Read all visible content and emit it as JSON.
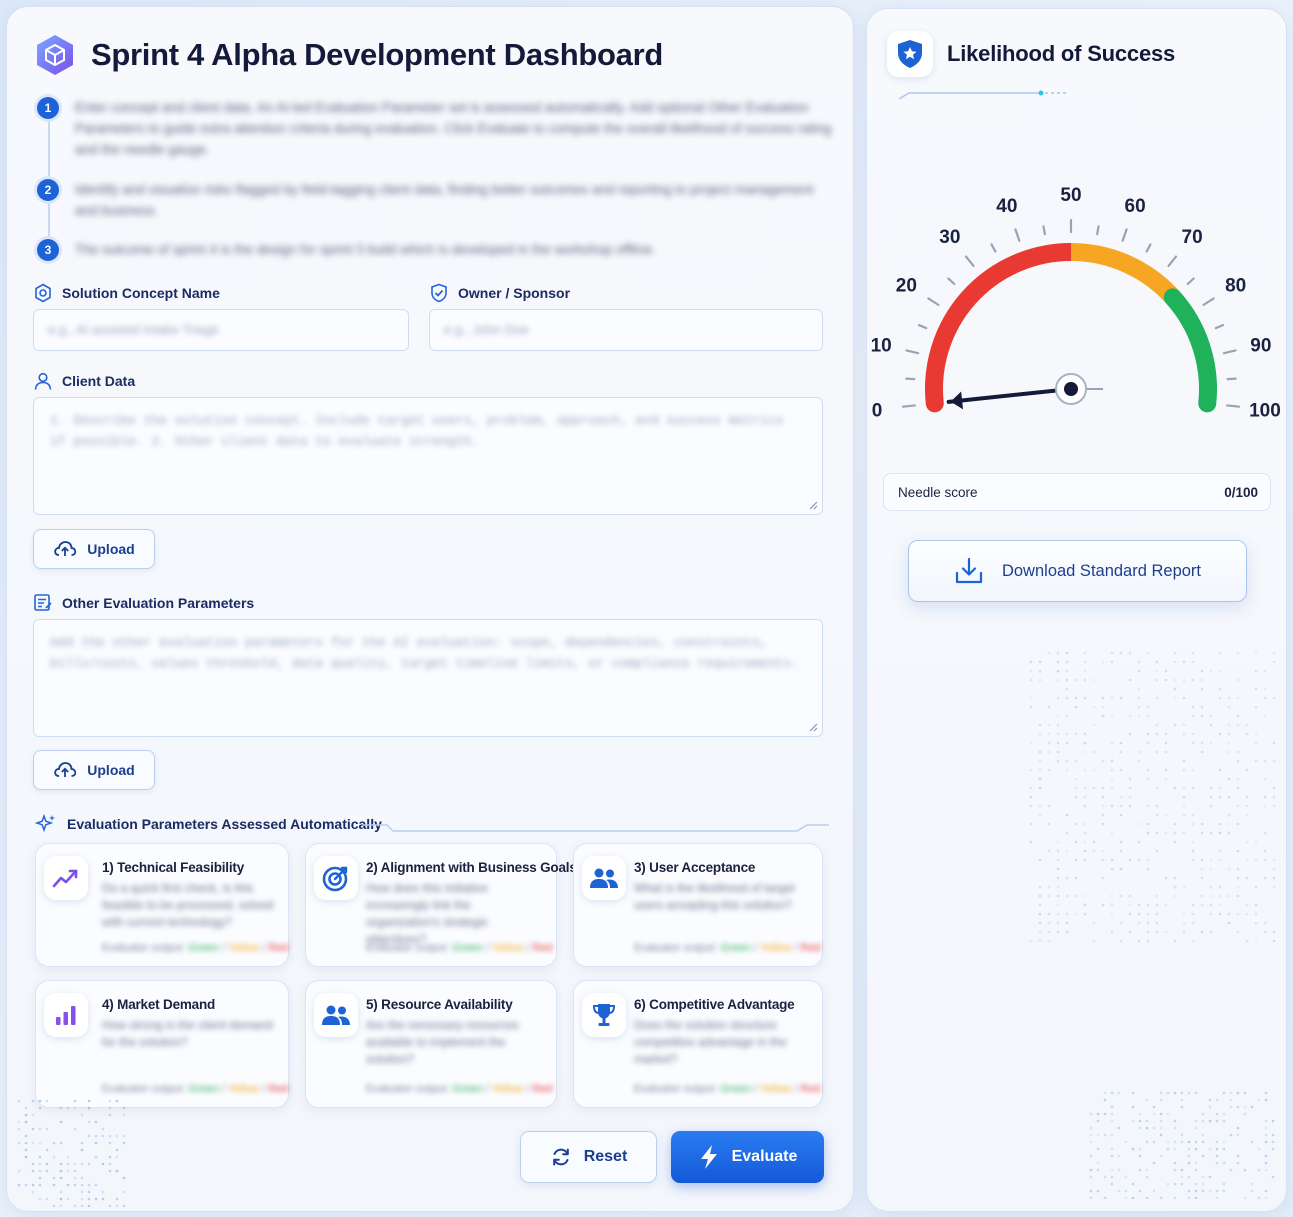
{
  "app": {
    "title": "Sprint 4 Alpha Development Dashboard"
  },
  "steps": [
    {
      "num": "1",
      "text": "Enter concept and client data. An AI-led Evaluation Parameter set is assessed automatically. Add optional Other Evaluation Parameters to guide extra attention criteria during evaluation. Click Evaluate to compute the overall likelihood of success rating and the needle gauge."
    },
    {
      "num": "2",
      "text": "Identify and visualize risks flagged by field-tagging client data, finding better outcomes and reporting to project management and business."
    },
    {
      "num": "3",
      "text": "The outcome of sprint 4 is the design for sprint 5 build which is developed in the workshop offline."
    }
  ],
  "form": {
    "concept_label": "Solution Concept Name",
    "concept_placeholder": "e.g., AI assisted Intake Triage",
    "owner_label": "Owner / Sponsor",
    "owner_placeholder": "e.g., John Doe",
    "client_label": "Client Data",
    "client_placeholder": "1. Describe the solution concept. Include target users, problem, approach, and success metrics if possible. 2. Other client data to evaluate strength.",
    "other_label": "Other Evaluation Parameters",
    "other_placeholder": "Add the other evaluation parameters for the AI evaluation: scope, dependencies, constraints, bills/costs, values threshold, data quality, target timeline limits, or compliance requirements.",
    "upload_label": "Upload"
  },
  "auto": {
    "heading": "Evaluation Parameters Assessed Automatically",
    "cards": [
      {
        "title": "1) Technical Feasibility",
        "desc": "Do a quick first check, is this feasible to be processed, solved with current technology?",
        "foot_prefix": "Evaluator output:",
        "g": "Green",
        "y": "Yellow",
        "r": "Red"
      },
      {
        "title": "2) Alignment with Business Goals",
        "desc": "How does this initiative increasingly link the organization's strategic objectives?",
        "foot_prefix": "Evaluator output:",
        "g": "Green",
        "y": "Yellow",
        "r": "Red"
      },
      {
        "title": "3) User Acceptance",
        "desc": "What is the likelihood of target users accepting this solution?",
        "foot_prefix": "Evaluator output:",
        "g": "Green",
        "y": "Yellow",
        "r": "Red"
      },
      {
        "title": "4) Market Demand",
        "desc": "How strong is the client demand for the solution?",
        "foot_prefix": "Evaluator output:",
        "g": "Green",
        "y": "Yellow",
        "r": "Red"
      },
      {
        "title": "5) Resource Availability",
        "desc": "Are the necessary resources available to implement the solution?",
        "foot_prefix": "Evaluator output:",
        "g": "Green",
        "y": "Yellow",
        "r": "Red"
      },
      {
        "title": "6) Competitive Advantage",
        "desc": "Does the solution structure competitive advantage in the market?",
        "foot_prefix": "Evaluator output:",
        "g": "Green",
        "y": "Yellow",
        "r": "Red"
      }
    ]
  },
  "actions": {
    "reset_label": "Reset",
    "evaluate_label": "Evaluate"
  },
  "sidebar": {
    "title": "Likelihood of Success",
    "needle_label": "Needle score",
    "needle_value": "0/100",
    "download_label": "Download Standard Report"
  },
  "gauge": {
    "value": 0,
    "min": 0,
    "max": 100,
    "ticks": [
      "0",
      "10",
      "20",
      "30",
      "40",
      "50",
      "60",
      "70",
      "80",
      "90",
      "100"
    ],
    "zones": [
      {
        "from": 0,
        "to": 50,
        "color": "#e83a32"
      },
      {
        "from": 50,
        "to": 75,
        "color": "#f6a623"
      },
      {
        "from": 75,
        "to": 100,
        "color": "#1fb25a"
      }
    ]
  },
  "colors": {
    "accent": "#1e63d6",
    "title": "#141a3a",
    "label": "#1c2b63"
  }
}
